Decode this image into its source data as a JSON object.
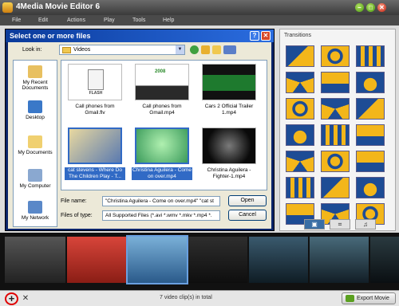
{
  "app": {
    "title": "4Media Movie Editor 6",
    "window_buttons": [
      "–",
      "□",
      "✕"
    ],
    "menu": [
      "File",
      "Edit",
      "Actions",
      "Play",
      "Tools",
      "Help"
    ]
  },
  "dialog": {
    "title": "Select one or more files",
    "help_button": "?",
    "close_button": "✕",
    "look_in_label": "Look in:",
    "look_in_value": "Videos",
    "places": [
      {
        "label": "My Recent Documents",
        "icon": "recent-documents-icon"
      },
      {
        "label": "Desktop",
        "icon": "desktop-icon"
      },
      {
        "label": "My Documents",
        "icon": "my-documents-icon"
      },
      {
        "label": "My Computer",
        "icon": "my-computer-icon"
      },
      {
        "label": "My Network",
        "icon": "my-network-icon"
      }
    ],
    "files": [
      {
        "name": "Call phones from Gmail.flv",
        "selected": false
      },
      {
        "name": "Call phones from Gmail.mp4",
        "selected": false
      },
      {
        "name": "Cars 2 Official Trailer 1.mp4",
        "selected": false
      },
      {
        "name": "cat stevens - Where Do The Children Play - T...",
        "selected": true
      },
      {
        "name": "Christina Aguilera - Come on over.mp4",
        "selected": true
      },
      {
        "name": "Christina Aguilera - Fighter-1.mp4",
        "selected": false
      }
    ],
    "thumb_caption_2008": "2008",
    "flash_label": "FLASH",
    "file_name_label": "File name:",
    "file_name_value": "\"Christina Aguilera - Come on over.mp4\" \"cat st",
    "file_type_label": "Files of type:",
    "file_type_value": "All Supported Files (*.avi *.wmv *.mkv *.mp4 *.",
    "open_button": "Open",
    "cancel_button": "Cancel"
  },
  "transitions": {
    "header": "Transitions",
    "tabs": [
      "▣",
      "⌗",
      "♫"
    ]
  },
  "bottom": {
    "add_button": "+",
    "remove_button": "✕",
    "status": "7 video clip(s) in total",
    "export_button": "Export Movie"
  }
}
